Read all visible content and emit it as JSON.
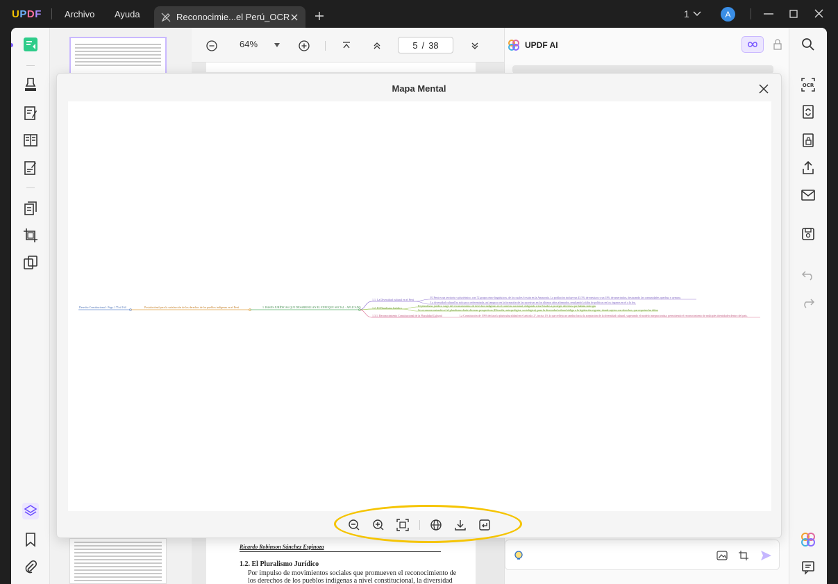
{
  "titlebar": {
    "logo": {
      "u": "U",
      "p": "P",
      "d": "D",
      "f": "F"
    },
    "menu": [
      "Archivo",
      "Ayuda"
    ],
    "tab_title": "Reconocimie...el Perú_OCR",
    "page_selector": "1",
    "avatar": "A"
  },
  "doc_toolbar": {
    "zoom": "64%",
    "current_page": "5",
    "separator": "/",
    "total_pages": "38"
  },
  "doc_page_bottom": {
    "author": "Ricardo Robinson Sánchez Espinoza",
    "heading": "1.2. El Pluralismo Jurídico",
    "body_lines": [
      "Por impulso de movimientos sociales que promueven el reconocimiento de",
      "los derechos de los pueblos indígenas a nivel constitucional, la diversidad"
    ]
  },
  "ai_panel": {
    "title": "UPDF AI",
    "input_placeholder": ""
  },
  "modal": {
    "title": "Mapa Mental",
    "mindmap": {
      "root": "Derecho Constitucional · Pags. 175 al 164",
      "level1": "Postulaciónal para la satisfacción de los derechos de los pueblos indígenas en el Perú",
      "level2": "1. BASES JURÍDICAS QUE DESARROLLAN EL ENFOQUE SOCIAL · APLICADO",
      "branches": [
        {
          "label": "1.1. La Diversidad cultural en el Perú",
          "details": [
            "El Perú es un territorio y pluriétnico, con 72 grupos etno-lingüísticos, de los cuales 6 están en la Amazonía. La población incluye un 45.5% de mestizos y un 18% de amerindios, destacando las comunidades quechua y aymara.",
            "La diversidad cultural ha sido poco referenciada, así tampoco en la formación de las sucesivas en los últimos años afirmados, resultando la falta de políticas en los órganos en el a la ley."
          ],
          "color": "#9b7fd6"
        },
        {
          "label": "1.2. El Pluralismo Jurídico",
          "details": [
            "El pluralismo jurídico surge del reconocimiento de derechos indígenas en el contexto nacional, obligando a los Estados a proteger derechos que habían sido ignorados.",
            "Se reconocen naturales el el pluralismo desde diversas perspectivas (Filosofía, antropológica, sociológica), pues la diversidad cultural obliga a la legislación vigente, donde sujetos con derechos, que respeten las diferencias culturales."
          ],
          "color": "#8fbf3a"
        },
        {
          "label": "1.3.1. Reconocimiento Constitucional de la Pluralidad Cultural",
          "details": [
            "La Constitución de 1993 declara la pluriculturalidad en el artículo 2°, inciso 19, lo que refleja un cambio hacia la aceptación de la diversidad cultural, superando el modelo integracionista, permitiendo el reconocimiento de múltiples identidades dentro del país."
          ],
          "color": "#e07a9c"
        }
      ]
    }
  },
  "colors": {
    "highlight": "#f5c400",
    "accent": "#3a8ee6",
    "root_line": "#6a8fd0",
    "level1_line": "#e0a040",
    "level2_line": "#5ab06a"
  }
}
